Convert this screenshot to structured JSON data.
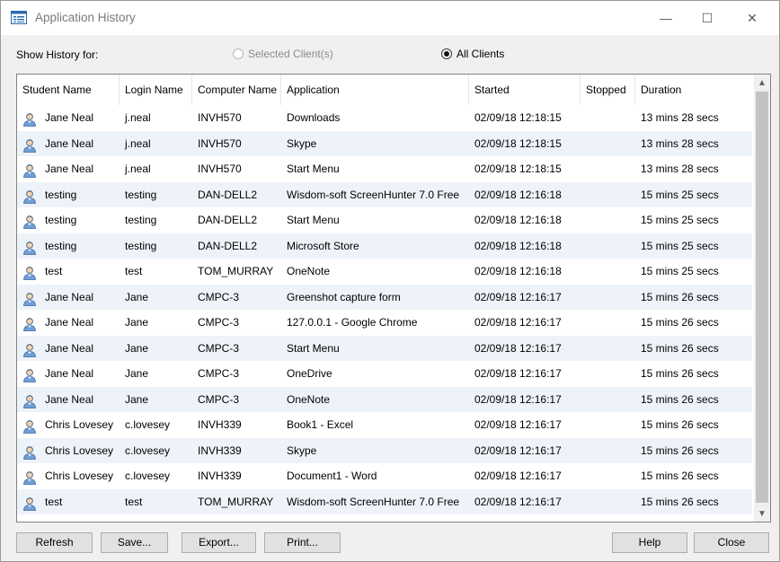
{
  "window": {
    "title": "Application History",
    "controls": {
      "minimize": "—",
      "maximize": "☐",
      "close": "✕"
    },
    "icon": "window-list-icon"
  },
  "filter": {
    "label": "Show History for:",
    "options": [
      {
        "label": "Selected Client(s)",
        "selected": false,
        "enabled": false
      },
      {
        "label": "All Clients",
        "selected": true,
        "enabled": true
      }
    ]
  },
  "table": {
    "columns": [
      "Student Name",
      "Login Name",
      "Computer Name",
      "Application",
      "Started",
      "Stopped",
      "Duration"
    ],
    "rows": [
      {
        "student": "Jane Neal",
        "login": "j.neal",
        "computer": "INVH570",
        "application": "Downloads",
        "started": "02/09/18 12:18:15",
        "stopped": "",
        "duration": "13 mins 28 secs"
      },
      {
        "student": "Jane Neal",
        "login": "j.neal",
        "computer": "INVH570",
        "application": "Skype",
        "started": "02/09/18 12:18:15",
        "stopped": "",
        "duration": "13 mins 28 secs"
      },
      {
        "student": "Jane Neal",
        "login": "j.neal",
        "computer": "INVH570",
        "application": "Start Menu",
        "started": "02/09/18 12:18:15",
        "stopped": "",
        "duration": "13 mins 28 secs"
      },
      {
        "student": "testing",
        "login": "testing",
        "computer": "DAN-DELL2",
        "application": "Wisdom-soft ScreenHunter 7.0 Free",
        "started": "02/09/18 12:16:18",
        "stopped": "",
        "duration": "15 mins 25 secs"
      },
      {
        "student": "testing",
        "login": "testing",
        "computer": "DAN-DELL2",
        "application": "Start Menu",
        "started": "02/09/18 12:16:18",
        "stopped": "",
        "duration": "15 mins 25 secs"
      },
      {
        "student": "testing",
        "login": "testing",
        "computer": "DAN-DELL2",
        "application": "Microsoft Store",
        "started": "02/09/18 12:16:18",
        "stopped": "",
        "duration": "15 mins 25 secs"
      },
      {
        "student": "test",
        "login": "test",
        "computer": "TOM_MURRAY",
        "application": "OneNote",
        "started": "02/09/18 12:16:18",
        "stopped": "",
        "duration": "15 mins 25 secs"
      },
      {
        "student": "Jane Neal",
        "login": "Jane",
        "computer": "CMPC-3",
        "application": "Greenshot capture form",
        "started": "02/09/18 12:16:17",
        "stopped": "",
        "duration": "15 mins 26 secs"
      },
      {
        "student": "Jane Neal",
        "login": "Jane",
        "computer": "CMPC-3",
        "application": "127.0.0.1 - Google Chrome",
        "started": "02/09/18 12:16:17",
        "stopped": "",
        "duration": "15 mins 26 secs"
      },
      {
        "student": "Jane Neal",
        "login": "Jane",
        "computer": "CMPC-3",
        "application": "Start Menu",
        "started": "02/09/18 12:16:17",
        "stopped": "",
        "duration": "15 mins 26 secs"
      },
      {
        "student": "Jane Neal",
        "login": "Jane",
        "computer": "CMPC-3",
        "application": "OneDrive",
        "started": "02/09/18 12:16:17",
        "stopped": "",
        "duration": "15 mins 26 secs"
      },
      {
        "student": "Jane Neal",
        "login": "Jane",
        "computer": "CMPC-3",
        "application": "OneNote",
        "started": "02/09/18 12:16:17",
        "stopped": "",
        "duration": "15 mins 26 secs"
      },
      {
        "student": "Chris Lovesey",
        "login": "c.lovesey",
        "computer": "INVH339",
        "application": "Book1 - Excel",
        "started": "02/09/18 12:16:17",
        "stopped": "",
        "duration": "15 mins 26 secs"
      },
      {
        "student": "Chris Lovesey",
        "login": "c.lovesey",
        "computer": "INVH339",
        "application": "Skype",
        "started": "02/09/18 12:16:17",
        "stopped": "",
        "duration": "15 mins 26 secs"
      },
      {
        "student": "Chris Lovesey",
        "login": "c.lovesey",
        "computer": "INVH339",
        "application": "Document1 - Word",
        "started": "02/09/18 12:16:17",
        "stopped": "",
        "duration": "15 mins 26 secs"
      },
      {
        "student": "test",
        "login": "test",
        "computer": "TOM_MURRAY",
        "application": "Wisdom-soft ScreenHunter 7.0 Free",
        "started": "02/09/18 12:16:17",
        "stopped": "",
        "duration": "15 mins 26 secs"
      }
    ],
    "row_icon": "user-icon"
  },
  "scrollbar": {
    "up": "▲",
    "down": "▼"
  },
  "buttons": {
    "refresh": "Refresh",
    "save": "Save...",
    "export": "Export...",
    "print": "Print...",
    "help": "Help",
    "close": "Close"
  }
}
